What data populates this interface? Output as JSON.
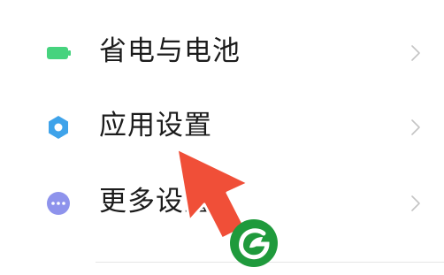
{
  "settings": {
    "items": [
      {
        "label": "省电与电池",
        "icon": "battery-icon",
        "color": "#46d37e"
      },
      {
        "label": "应用设置",
        "icon": "gear-icon",
        "color": "#3fa3ea"
      },
      {
        "label": "更多设置",
        "icon": "more-dots-icon",
        "color": "#8e93ec"
      }
    ]
  },
  "annotation": {
    "icon": "pointer-arrow",
    "color": "#f04f38"
  },
  "watermark": {
    "icon": "leaf-g-logo",
    "color": "#1f9a3c"
  }
}
